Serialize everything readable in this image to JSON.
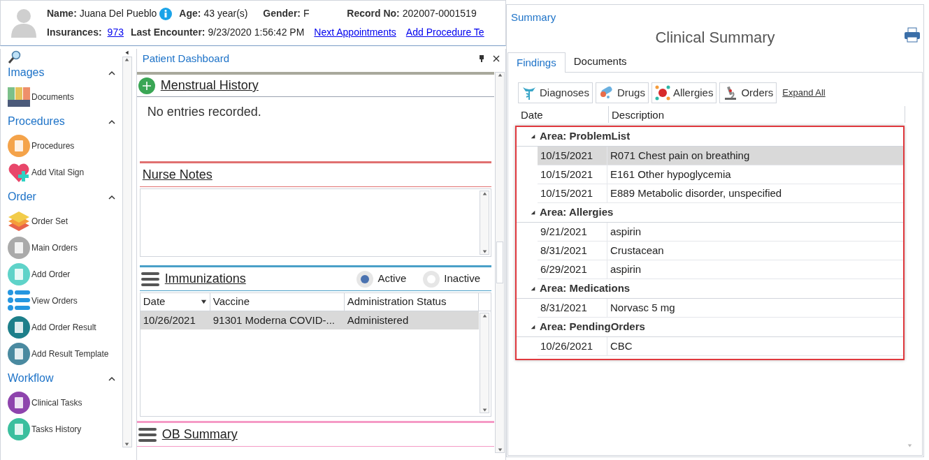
{
  "patient": {
    "fields": [
      {
        "label": "Name:",
        "value": "Juana Del Pueblo",
        "kind": "info"
      },
      {
        "label": "Age:",
        "value": "43 year(s)",
        "kind": "text"
      },
      {
        "label": "Gender:",
        "value": "F",
        "kind": "text"
      },
      {
        "label": "Record No:",
        "value": "202007-0001519",
        "kind": "text"
      },
      {
        "label": "Insurances:",
        "value": "973",
        "kind": "link"
      },
      {
        "label": "Last Encounter:",
        "value": "9/23/2020 1:56:42 PM",
        "kind": "text"
      },
      {
        "value": "Next Appointments",
        "kind": "bare_link"
      },
      {
        "value": "Add Procedure Te",
        "kind": "bare_link"
      }
    ]
  },
  "sidebar": {
    "sections": [
      {
        "title": "Images",
        "expanded": true,
        "items": [
          {
            "label": "Documents"
          }
        ]
      },
      {
        "title": "Procedures",
        "expanded": true,
        "items": [
          {
            "label": "Procedures"
          },
          {
            "label": "Add Vital Sign"
          }
        ]
      },
      {
        "title": "Order",
        "expanded": true,
        "items": [
          {
            "label": "Order Set"
          },
          {
            "label": "Main Orders"
          },
          {
            "label": "Add Order"
          },
          {
            "label": "View Orders"
          },
          {
            "label": "Add Order Result"
          },
          {
            "label": "Add Result Template"
          }
        ]
      },
      {
        "title": "Workflow",
        "expanded": true,
        "items": [
          {
            "label": "Clinical Tasks"
          },
          {
            "label": "Tasks History"
          }
        ]
      }
    ]
  },
  "dashboard": {
    "title": "Patient Dashboard",
    "menstrual": {
      "title": "Menstrual History",
      "message": "No entries recorded."
    },
    "nurse_notes": {
      "title": "Nurse Notes"
    },
    "immunizations": {
      "title": "Immunizations",
      "filters": [
        {
          "label": "Active",
          "selected": true
        },
        {
          "label": "Inactive",
          "selected": false
        }
      ],
      "columns": [
        "Date",
        "Vaccine",
        "Administration Status"
      ],
      "rows": [
        {
          "cells": [
            "10/26/2021",
            "91301 Moderna COVID-...",
            "Administered"
          ],
          "selected": true
        }
      ]
    },
    "ob_summary": {
      "title": "OB Summary"
    }
  },
  "summary": {
    "title": "Summary",
    "heading": "Clinical Summary",
    "tabs": [
      {
        "label": "Findings",
        "selected": true
      },
      {
        "label": "Documents",
        "selected": false
      }
    ],
    "filters": [
      "Diagnoses",
      "Drugs",
      "Allergies",
      "Orders"
    ],
    "expand_all": "Expand All",
    "columns": [
      "Date",
      "Description"
    ],
    "groups": [
      {
        "title": "Area: ProblemList",
        "expanded": true,
        "rows": [
          {
            "date": "10/15/2021",
            "description": "R071 Chest pain on breathing",
            "selected": true
          },
          {
            "date": "10/15/2021",
            "description": "E161 Other hypoglycemia",
            "selected": false
          },
          {
            "date": "10/15/2021",
            "description": "E889 Metabolic disorder, unspecified",
            "selected": false
          }
        ]
      },
      {
        "title": "Area: Allergies",
        "expanded": true,
        "rows": [
          {
            "date": "9/21/2021",
            "description": "aspirin",
            "selected": false
          },
          {
            "date": "8/31/2021",
            "description": "Crustacean",
            "selected": false
          },
          {
            "date": "6/29/2021",
            "description": "aspirin",
            "selected": false
          }
        ]
      },
      {
        "title": "Area: Medications",
        "expanded": true,
        "rows": [
          {
            "date": "8/31/2021",
            "description": "Norvasc 5 mg",
            "selected": false
          }
        ]
      },
      {
        "title": "Area: PendingOrders",
        "expanded": true,
        "rows": [
          {
            "date": "10/26/2021",
            "description": "CBC",
            "selected": false
          }
        ]
      }
    ]
  }
}
